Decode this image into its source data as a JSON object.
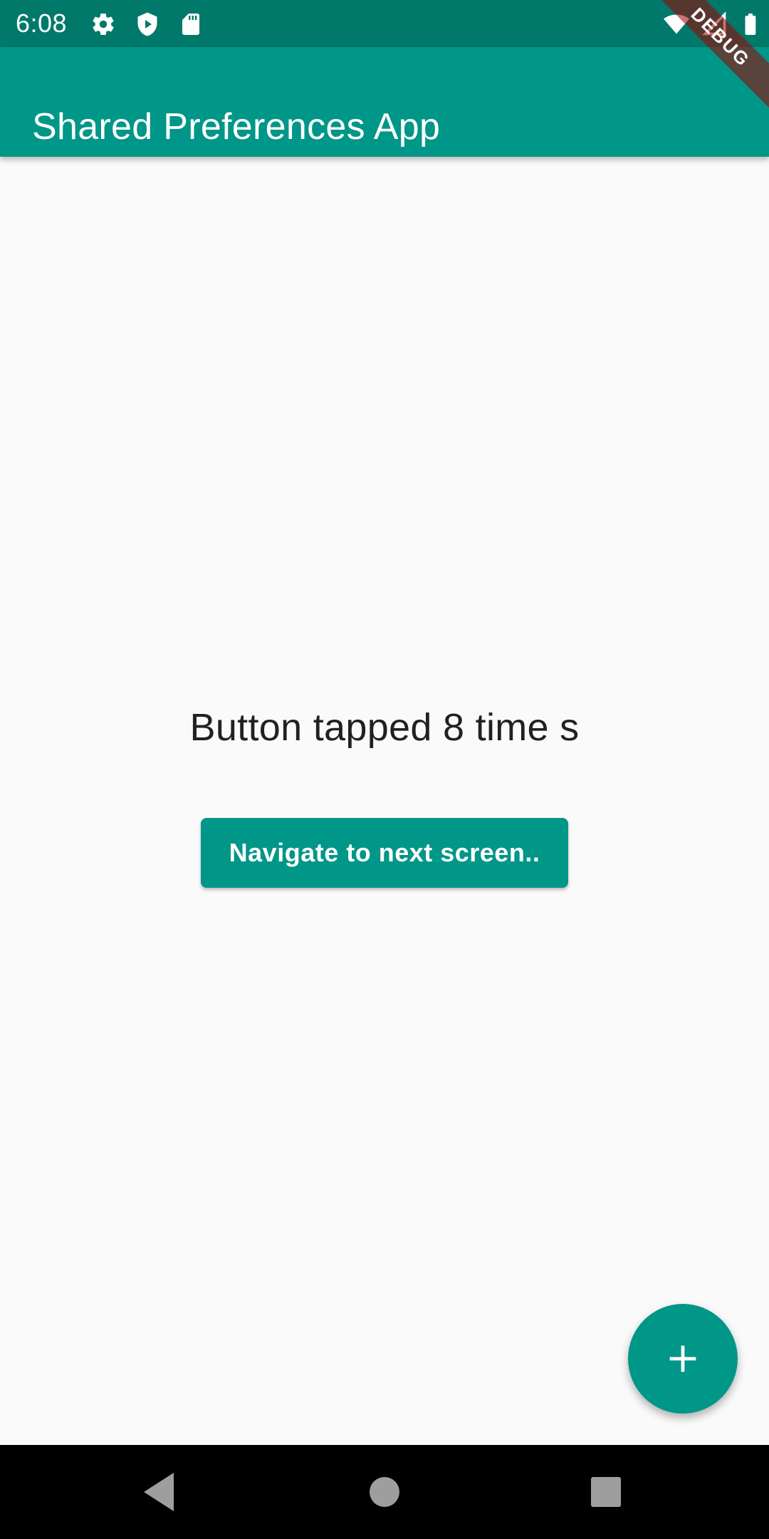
{
  "status_bar": {
    "time": "6:08",
    "icons": [
      "gear-icon",
      "shield-play-icon",
      "sd-card-icon",
      "wifi-icon",
      "cell-signal-icon",
      "battery-icon"
    ]
  },
  "app_bar": {
    "title": "Shared Preferences App"
  },
  "debug_banner": {
    "label": "DEBUG"
  },
  "main": {
    "counter_text": "Button tapped 8 time s",
    "navigate_button_label": "Navigate to next screen.."
  },
  "fab": {
    "icon": "plus-icon"
  },
  "navigation_bar": {
    "buttons": [
      "back-icon",
      "home-icon",
      "recents-icon"
    ]
  },
  "colors": {
    "primary": "#009688",
    "primary_dark": "#00796b",
    "background": "#fafafa",
    "text": "#212121",
    "nav_bar": "#000000"
  }
}
